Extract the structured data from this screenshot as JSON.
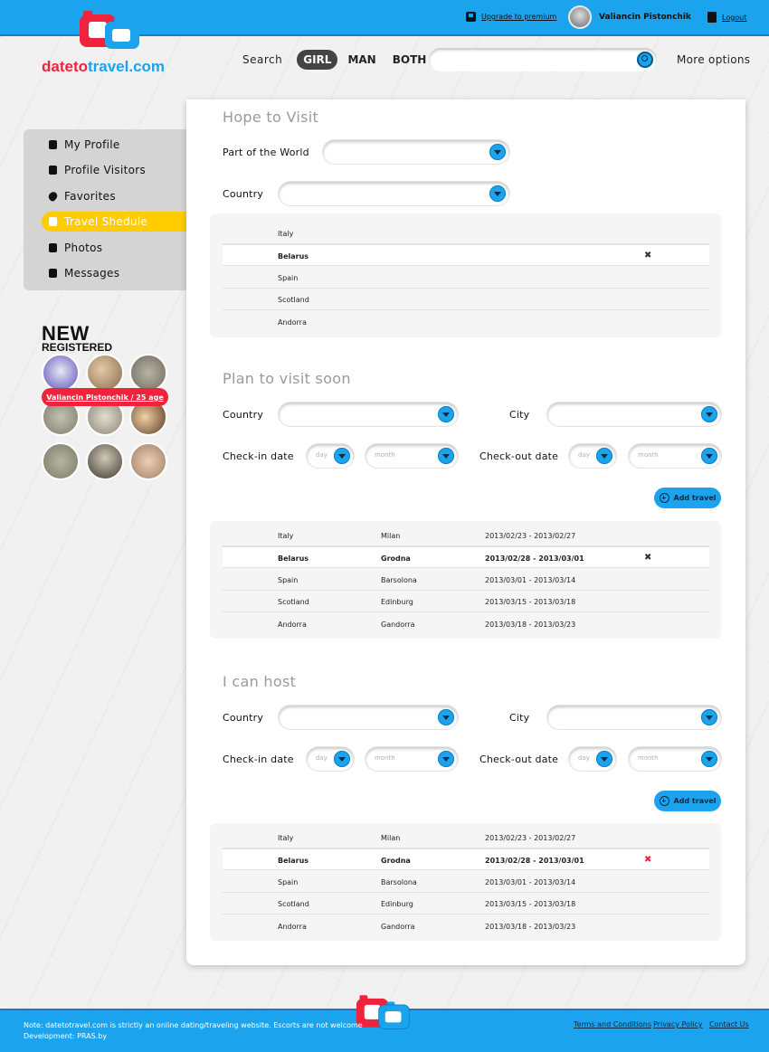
{
  "brand": {
    "name_part1": "dateto",
    "name_part2": "travel.com",
    "accent": "#1ba3ee",
    "red": "#ef233c",
    "yellow": "#ffcc00"
  },
  "topbar": {
    "upgrade_label": "Upgrade to premium",
    "user_name": "Valiancin Pistonchik",
    "logout_label": "Logout"
  },
  "search": {
    "label": "Search",
    "genders": [
      "GIRL",
      "MAN",
      "BOTH"
    ],
    "selected_gender": "GIRL",
    "query": "",
    "more_options": "More options"
  },
  "sidebar": {
    "items": [
      {
        "label": "My Profile",
        "icon": "user-icon"
      },
      {
        "label": "Profile Visitors",
        "icon": "users-icon"
      },
      {
        "label": "Favorites",
        "icon": "heart-icon"
      },
      {
        "label": "Travel Shedule",
        "icon": "suitcase-icon",
        "active": true
      },
      {
        "label": "Photos",
        "icon": "photo-icon"
      },
      {
        "label": "Messages",
        "icon": "message-icon"
      }
    ]
  },
  "new_registered": {
    "title_line1": "NEW",
    "title_line2": "REGISTERED",
    "tooltip": "Valiancin Pistonchik / 25 age"
  },
  "hope": {
    "title": "Hope to Visit",
    "part_label": "Part of the World",
    "country_label": "Country",
    "rows": [
      {
        "country": "Italy"
      },
      {
        "country": "Belarus",
        "selected": true
      },
      {
        "country": "Spain"
      },
      {
        "country": "Scotland"
      },
      {
        "country": "Andorra"
      }
    ]
  },
  "plan": {
    "title": "Plan to visit soon",
    "country_label": "Country",
    "city_label": "City",
    "checkin_label": "Check-in date",
    "checkout_label": "Check-out date",
    "day_placeholder": "day",
    "month_placeholder": "month",
    "add_label": "Add travel",
    "rows": [
      {
        "country": "Italy",
        "city": "Milan",
        "dates": "2013/02/23 - 2013/02/27"
      },
      {
        "country": "Belarus",
        "city": "Grodna",
        "dates": "2013/02/28 - 2013/03/01",
        "selected": true
      },
      {
        "country": "Spain",
        "city": "Barsolona",
        "dates": "2013/03/01 - 2013/03/14"
      },
      {
        "country": "Scotland",
        "city": "Edinburg",
        "dates": "2013/03/15 - 2013/03/18"
      },
      {
        "country": "Andorra",
        "city": "Gandorra",
        "dates": "2013/03/18 - 2013/03/23"
      }
    ]
  },
  "host": {
    "title": "I can host",
    "country_label": "Country",
    "city_label": "City",
    "checkin_label": "Check-in date",
    "checkout_label": "Check-out date",
    "day_placeholder": "day",
    "month_placeholder": "month",
    "add_label": "Add travel",
    "rows": [
      {
        "country": "Italy",
        "city": "Milan",
        "dates": "2013/02/23 - 2013/02/27"
      },
      {
        "country": "Belarus",
        "city": "Grodna",
        "dates": "2013/02/28 - 2013/03/01",
        "selected": true
      },
      {
        "country": "Spain",
        "city": "Barsolona",
        "dates": "2013/03/01 - 2013/03/14"
      },
      {
        "country": "Scotland",
        "city": "Edinburg",
        "dates": "2013/03/15 - 2013/03/18"
      },
      {
        "country": "Andorra",
        "city": "Gandorra",
        "dates": "2013/03/18 - 2013/03/23"
      }
    ]
  },
  "footer": {
    "note": "Note: datetotravel.com is strictly an online dating/traveling website. Escorts are not welcome",
    "dev": "Development: PRAS.by",
    "links": [
      "Terms and Conditions",
      "Privacy Policy",
      "Contact Us"
    ]
  }
}
